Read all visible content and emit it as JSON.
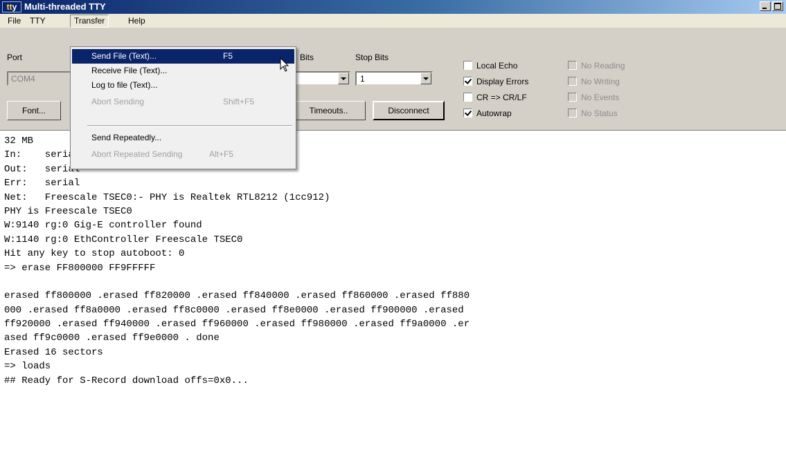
{
  "window": {
    "icon_text_1": "tt",
    "icon_text_2": "y",
    "title": "Multi-threaded TTY"
  },
  "menubar": [
    "File",
    "TTY",
    "Transfer",
    "Help"
  ],
  "toolbar": {
    "port_label": "Port",
    "port_value": "COM4",
    "bits_label": "Bits",
    "stop_bits_label": "Stop Bits",
    "stop_bits_value": "1",
    "font_button": "Font...",
    "timeouts_button": "Timeouts..",
    "disconnect_button": "Disconnect",
    "checkboxes": [
      {
        "label": "Local Echo",
        "checked": false,
        "enabled": true
      },
      {
        "label": "Display Errors",
        "checked": true,
        "enabled": true
      },
      {
        "label": "CR => CR/LF",
        "checked": false,
        "enabled": true
      },
      {
        "label": "Autowrap",
        "checked": true,
        "enabled": true
      },
      {
        "label": "No Reading",
        "checked": false,
        "enabled": false
      },
      {
        "label": "No Writing",
        "checked": false,
        "enabled": false
      },
      {
        "label": "No Events",
        "checked": false,
        "enabled": false
      },
      {
        "label": "No Status",
        "checked": false,
        "enabled": false
      }
    ]
  },
  "transfer_menu": [
    {
      "label": "Send File (Text)...",
      "shortcut": "F5",
      "enabled": true,
      "highlighted": true
    },
    {
      "label": "Receive File (Text)...",
      "shortcut": "",
      "enabled": true
    },
    {
      "label": "Log to file (Text)...",
      "shortcut": "",
      "enabled": true
    },
    {
      "label": "Abort Sending",
      "shortcut": "Shift+F5",
      "enabled": false
    },
    {
      "label": "Send Repeatedly...",
      "shortcut": "",
      "enabled": true
    },
    {
      "label": "Abort Repeated Sending",
      "shortcut": "Alt+F5",
      "enabled": false
    }
  ],
  "terminal_lines": [
    "32 MB",
    "In:    serial",
    "Out:   serial",
    "Err:   serial",
    "Net:   Freescale TSEC0:- PHY is Realtek RTL8212 (1cc912)",
    "PHY is Freescale TSEC0",
    "W:9140 rg:0 Gig-E controller found",
    "W:1140 rg:0 EthController Freescale TSEC0",
    "Hit any key to stop autoboot: 0",
    "=> erase FF800000 FF9FFFFF",
    "",
    "erased ff800000 .erased ff820000 .erased ff840000 .erased ff860000 .erased ff880",
    "000 .erased ff8a0000 .erased ff8c0000 .erased ff8e0000 .erased ff900000 .erased",
    "ff920000 .erased ff940000 .erased ff960000 .erased ff980000 .erased ff9a0000 .er",
    "ased ff9c0000 .erased ff9e0000 . done",
    "Erased 16 sectors",
    "=> loads",
    "## Ready for S-Record download offs=0x0..."
  ]
}
